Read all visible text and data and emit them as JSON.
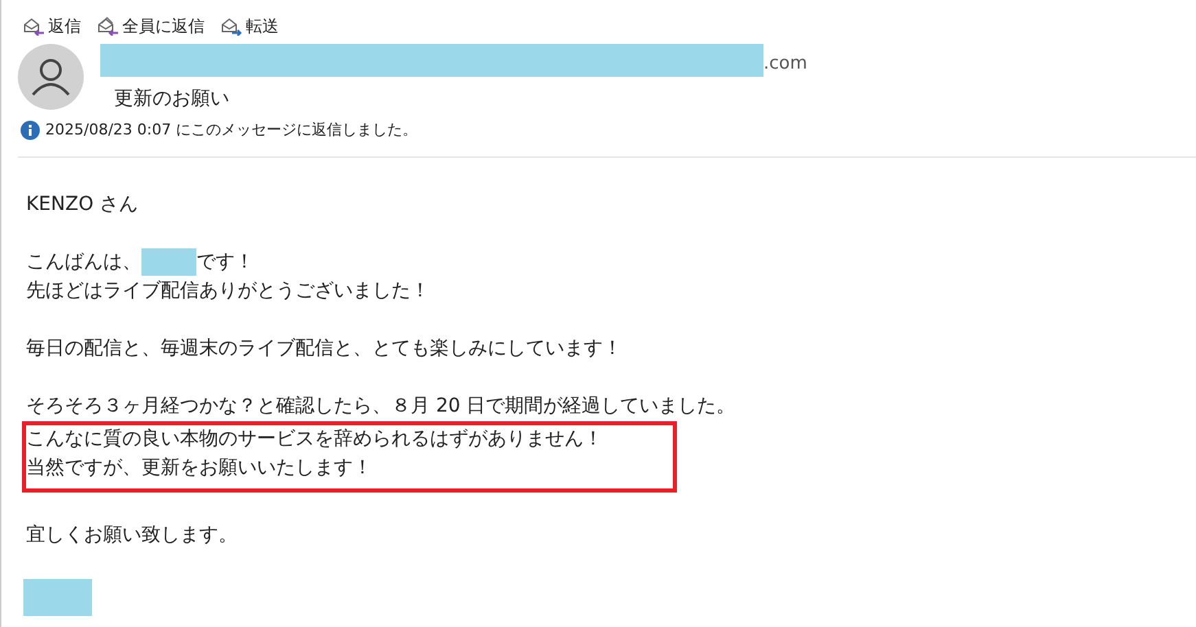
{
  "toolbar": [
    {
      "label": "返信",
      "kind": "reply"
    },
    {
      "label": "全員に返信",
      "kind": "reply_all"
    },
    {
      "label": "転送",
      "kind": "forward"
    }
  ],
  "header": {
    "sender_suffix": ".com",
    "subject": "更新のお願い",
    "info": "2025/08/23 0:07 にこのメッセージに返信しました。"
  },
  "body": [
    {
      "highlighted": false,
      "lines": [
        {
          "kind": "text",
          "text": "KENZO さん"
        }
      ]
    },
    {
      "highlighted": false,
      "lines": [
        {
          "kind": "redacted",
          "before": "こんばんは、",
          "after": "です！"
        },
        {
          "kind": "text",
          "text": "先ほどはライブ配信ありがとうございました！"
        }
      ]
    },
    {
      "highlighted": false,
      "lines": [
        {
          "kind": "text",
          "text": "毎日の配信と、毎週末のライブ配信と、とても楽しみにしています！"
        }
      ]
    },
    {
      "highlighted": false,
      "lines": [
        {
          "kind": "text",
          "text": "そろそろ３ヶ月経つかな？と確認したら、８月 20 日で期間が経過していました。"
        }
      ]
    },
    {
      "highlighted": true,
      "lines": [
        {
          "kind": "text",
          "text": "こんなに質の良い本物のサービスを辞められるはずがありません！"
        },
        {
          "kind": "text",
          "text": "当然ですが、更新をお願いいたします！"
        }
      ]
    },
    {
      "highlighted": false,
      "lines": [
        {
          "kind": "text",
          "text": "宜しくお願い致します。"
        }
      ]
    }
  ]
}
